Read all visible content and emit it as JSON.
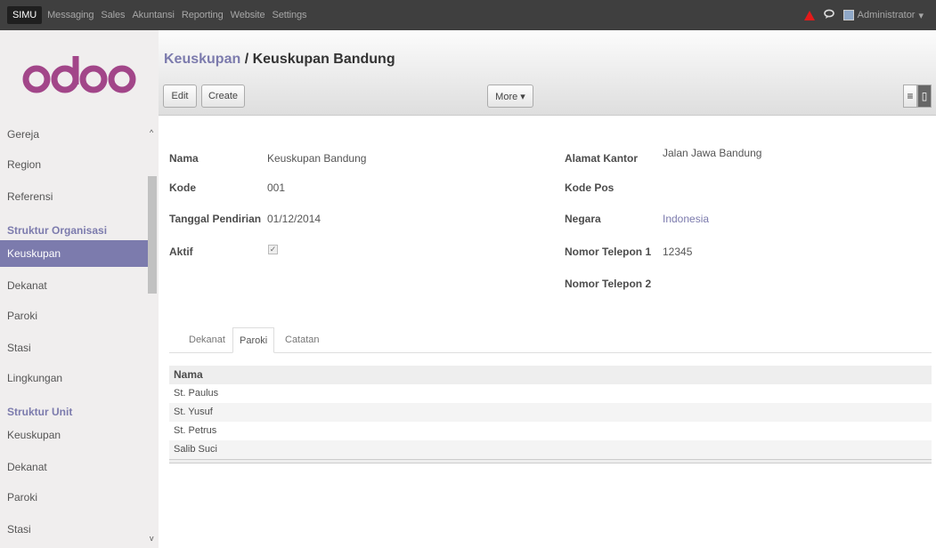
{
  "topbar": {
    "menu": [
      "SIMU",
      "Messaging",
      "Sales",
      "Akuntansi",
      "Reporting",
      "Website",
      "Settings"
    ],
    "user": "Administrator",
    "user_caret": "▾"
  },
  "logo": {
    "text": "odoo",
    "color": "#a24689"
  },
  "sidebar": {
    "items_top": [
      "Gereja",
      "Region",
      "Referensi"
    ],
    "group1_title": "Struktur Organisasi",
    "group1": [
      "Keuskupan",
      "Dekanat",
      "Paroki",
      "Stasi",
      "Lingkungan"
    ],
    "group2_title": "Struktur Unit",
    "group2": [
      "Keuskupan",
      "Dekanat",
      "Paroki",
      "Stasi"
    ],
    "scroll_up": "^",
    "scroll_down": "v"
  },
  "breadcrumb": {
    "parent": "Keuskupan",
    "separator": " / ",
    "current": "Keuskupan Bandung"
  },
  "buttons": {
    "edit": "Edit",
    "create": "Create",
    "more": "More ▾"
  },
  "view_icons": {
    "list": "≡",
    "form": "▯"
  },
  "form": {
    "left": [
      {
        "label": "Nama",
        "value": "Keuskupan Bandung"
      },
      {
        "label": "Kode",
        "value": "001"
      },
      {
        "label": "Tanggal Pendirian",
        "value": "01/12/2014"
      },
      {
        "label": "Aktif",
        "value": "✓"
      }
    ],
    "right": [
      {
        "label": "Alamat Kantor",
        "value": "Jalan Jawa Bandung"
      },
      {
        "label": "Kode Pos",
        "value": ""
      },
      {
        "label": "Negara",
        "value": "Indonesia"
      },
      {
        "label": "Nomor Telepon 1",
        "value": "12345"
      },
      {
        "label": "Nomor Telepon 2",
        "value": ""
      }
    ]
  },
  "tabs": [
    "Dekanat",
    "Paroki",
    "Catatan"
  ],
  "table": {
    "header": "Nama",
    "rows": [
      "St. Paulus",
      "St. Yusuf",
      "St. Petrus",
      "Salib Suci"
    ]
  },
  "colors": {
    "accent": "#7c7bad",
    "topbar": "#3f3f3f",
    "alert": "#e31a1a"
  }
}
